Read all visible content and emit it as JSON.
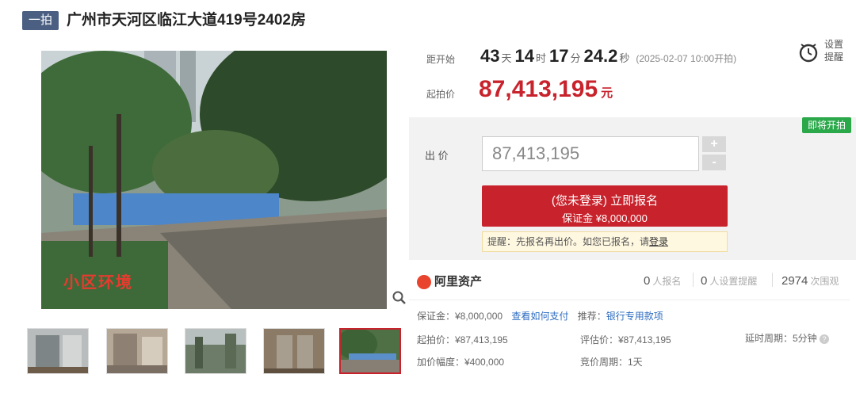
{
  "header": {
    "tag": "一拍",
    "title": "广州市天河区临江大道419号2402房"
  },
  "gallery": {
    "caption": "小区环境",
    "thumb_count": 5,
    "active_index": 4
  },
  "countdown": {
    "label": "距开始",
    "days": "43",
    "days_unit": "天",
    "hours": "14",
    "hours_unit": "时",
    "minutes": "17",
    "minutes_unit": "分",
    "seconds": "24.2",
    "seconds_unit": "秒",
    "start_note": "(2025-02-07 10:00开拍)"
  },
  "remind": {
    "line1": "设置",
    "line2": "提醒"
  },
  "starting_price": {
    "label": "起拍价",
    "value": "87,413,195",
    "unit": "元"
  },
  "status_badge": "即将开拍",
  "bid": {
    "label": "出 价",
    "value": "87,413,195",
    "plus": "+",
    "minus": "-"
  },
  "signup_button": {
    "line1": "(您未登录) 立即报名",
    "line2": "保证金 ¥8,000,000"
  },
  "tip": {
    "prefix": "提醒：先报名再出价。如您已报名，请",
    "link": "登录"
  },
  "platform": {
    "name": "阿里资产"
  },
  "stats": [
    {
      "value": "0",
      "label": "人报名"
    },
    {
      "value": "0",
      "label": "人设置提醒"
    },
    {
      "value": "2974",
      "label": "次围观"
    }
  ],
  "details": {
    "deposit_label": "保证金：¥8,000,000",
    "how_to_pay": "查看如何支付",
    "recommend_label": "推荐：",
    "recommend_link": "银行专用款项",
    "start_price": "起拍价：¥87,413,195",
    "appraisal": "评估价：¥87,413,195",
    "delay": "延时周期：5分钟",
    "increment": "加价幅度：¥400,000",
    "auction_period": "竞价周期：1天"
  },
  "colors": {
    "accent": "#c8232c",
    "badge_green": "#2aa84a",
    "tag_blue": "#4a5f82",
    "link": "#2d6cc0"
  }
}
